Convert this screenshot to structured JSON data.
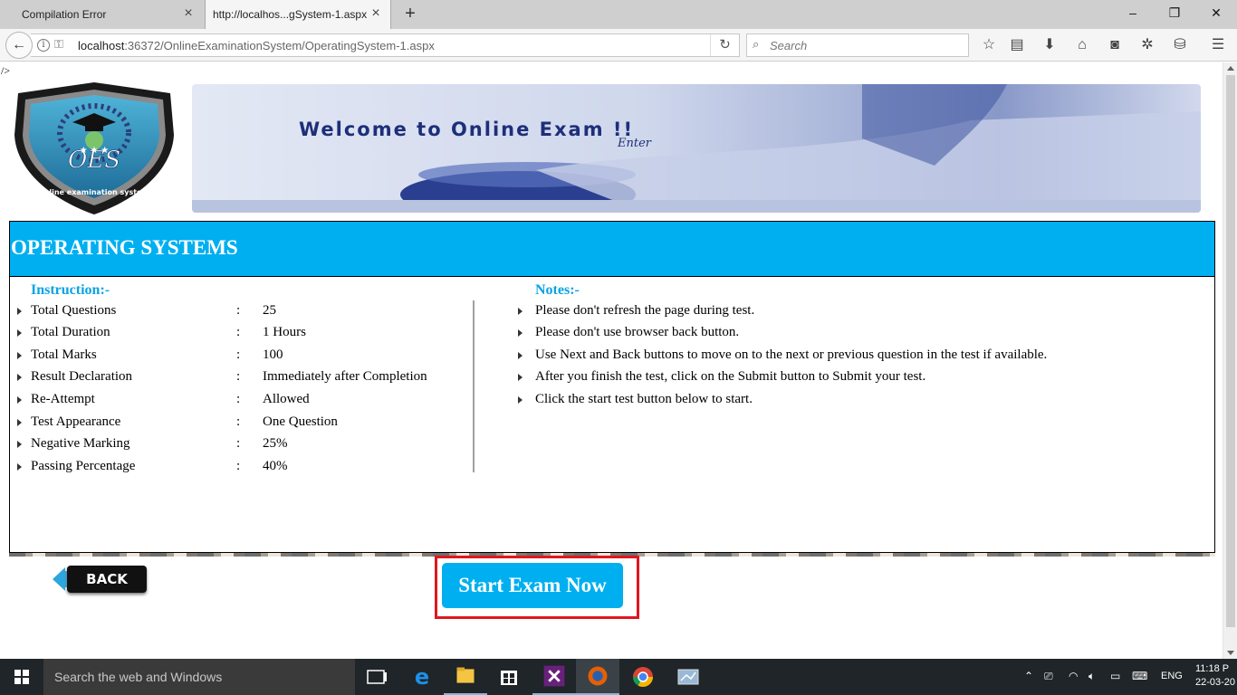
{
  "browser": {
    "tabs": [
      {
        "label": "Compilation Error",
        "active": false
      },
      {
        "label": "http://localhos...gSystem-1.aspx",
        "active": true
      }
    ],
    "url": {
      "host": "localhost",
      "rest": ":36372/OnlineExaminationSystem/OperatingSystem-1.aspx"
    },
    "search_placeholder": "Search"
  },
  "page": {
    "stray_text": "/>",
    "logo": {
      "text": "OES",
      "arc_text": "online examination system"
    },
    "banner": {
      "welcome": "Welcome to Online Exam !!",
      "enter": "Enter"
    },
    "heading": "OPERATING SYSTEMS",
    "instruction_title": "Instruction:-",
    "instructions": [
      {
        "label": "Total Questions",
        "sep": ":",
        "value": "25"
      },
      {
        "label": "Total Duration",
        "sep": ":",
        "value": "1 Hours"
      },
      {
        "label": "Total Marks",
        "sep": ":",
        "value": "100"
      },
      {
        "label": "Result Declaration",
        "sep": ":",
        "value": "Immediately after Completion"
      },
      {
        "label": "Re-Attempt",
        "sep": ":",
        "value": "Allowed"
      },
      {
        "label": "Test Appearance",
        "sep": ":",
        "value": "One Question"
      },
      {
        "label": "Negative Marking",
        "sep": ":",
        "value": "25%"
      },
      {
        "label": "Passing Percentage",
        "sep": ":",
        "value": "40%"
      }
    ],
    "notes_title": "Notes:-",
    "notes": [
      "Please don't refresh the page during test.",
      "Please don't use browser back button.",
      "Use Next and Back buttons to move on to the next or previous question in the test if available.",
      "After you finish the test, click on the Submit button to Submit your test.",
      "Click the start test button below to start."
    ],
    "back_label": "BACK",
    "start_label": "Start Exam Now"
  },
  "taskbar": {
    "search_text": "Search the web and Windows",
    "lang": "ENG",
    "time": "11:18 P",
    "date": "22-03-20"
  },
  "colors": {
    "accent": "#00aff0",
    "highlight_border": "#e0171e",
    "heading_blue": "#0aa3e3"
  }
}
